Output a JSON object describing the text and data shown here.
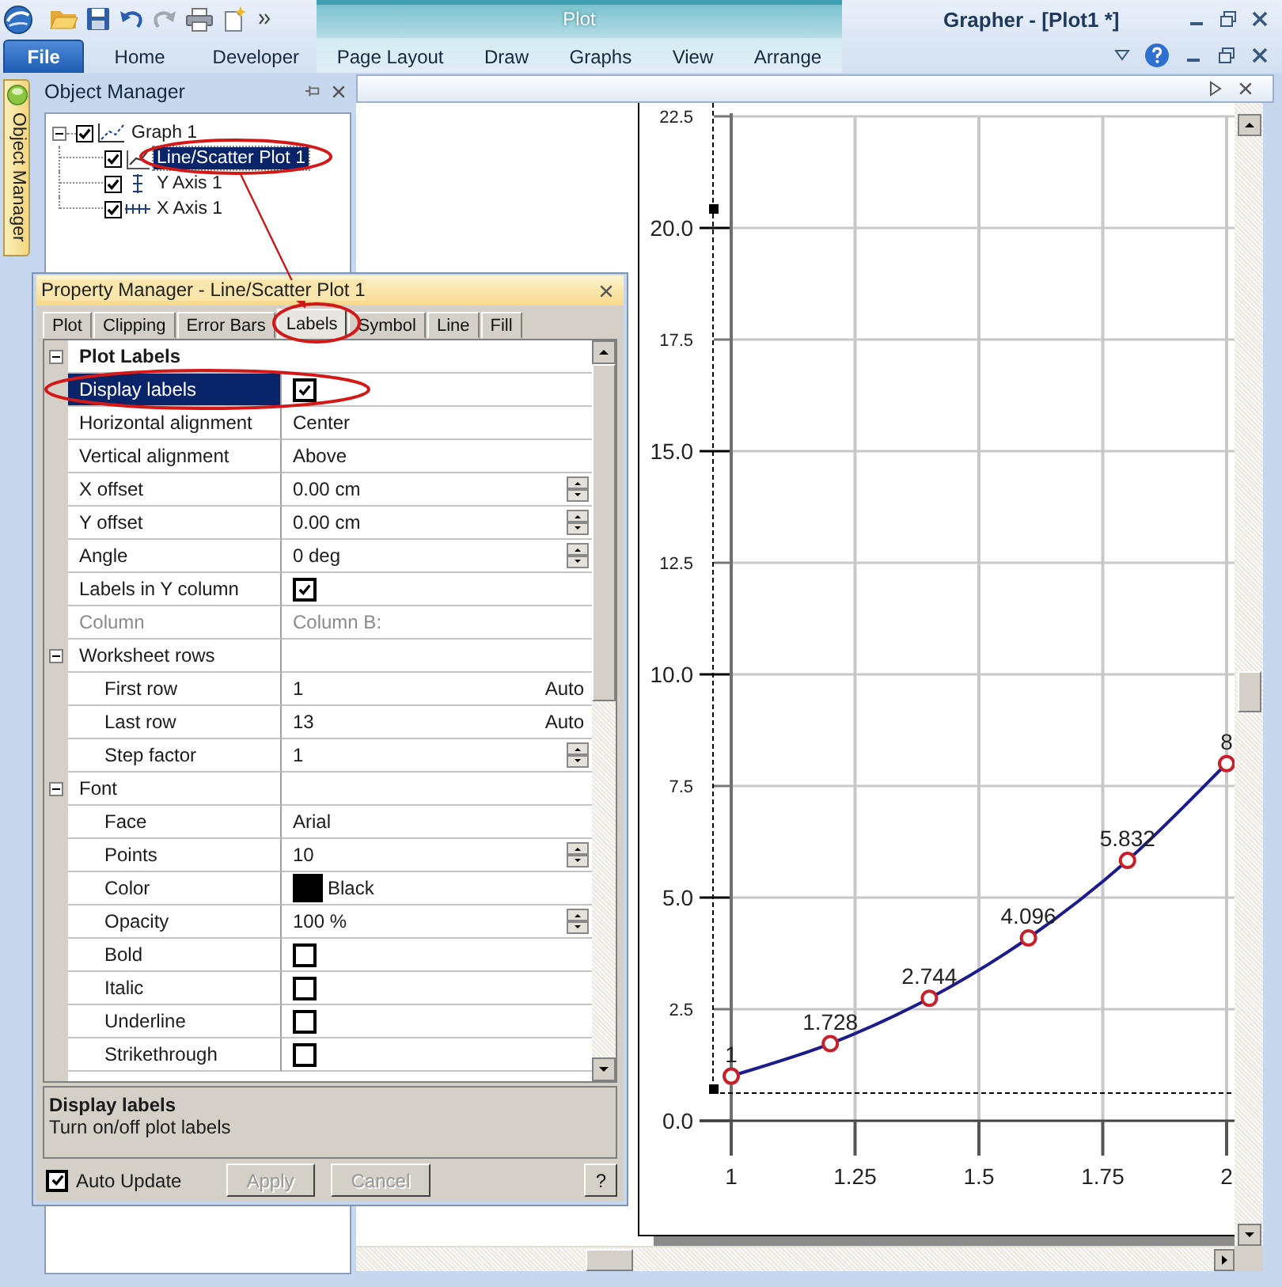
{
  "quick_access": [
    {
      "kind": "open",
      "disabled": false
    },
    {
      "kind": "save",
      "disabled": false
    },
    {
      "kind": "undo",
      "disabled": false
    },
    {
      "kind": "redo",
      "disabled": true
    },
    {
      "kind": "print",
      "disabled": false
    },
    {
      "kind": "new",
      "disabled": false
    },
    {
      "kind": "more",
      "disabled": false
    }
  ],
  "window": {
    "title": "Grapher - [Plot1 *]"
  },
  "ribbon": {
    "file_button": "File",
    "tabs": [
      {
        "label": "Home",
        "selected": false
      },
      {
        "label": "Developer",
        "selected": false
      }
    ],
    "context_group": {
      "label": "Plot",
      "tabs": [
        {
          "label": "Page Layout",
          "selected": false
        },
        {
          "label": "Draw",
          "selected": false
        },
        {
          "label": "Graphs",
          "selected": false
        },
        {
          "label": "View",
          "selected": false
        },
        {
          "label": "Arrange",
          "selected": false
        }
      ]
    }
  },
  "object_manager": {
    "side_tab": "Object Manager",
    "title": "Object Manager",
    "tree": [
      {
        "label": "Graph 1",
        "kind": "graph",
        "checked": true,
        "selected": false,
        "expanded": true,
        "children": [
          {
            "label": "Line/Scatter Plot 1",
            "kind": "plot",
            "checked": true,
            "selected": true
          },
          {
            "label": "Y Axis 1",
            "kind": "y_axis",
            "checked": true,
            "selected": false
          },
          {
            "label": "X Axis 1",
            "kind": "x_axis",
            "checked": true,
            "selected": false
          }
        ]
      }
    ]
  },
  "property_manager": {
    "title": "Property Manager - Line/Scatter Plot 1",
    "tabs": [
      {
        "label": "Plot",
        "selected": false
      },
      {
        "label": "Clipping",
        "selected": false
      },
      {
        "label": "Error Bars",
        "selected": false
      },
      {
        "label": "Labels",
        "selected": true
      },
      {
        "label": "Symbol",
        "selected": false
      },
      {
        "label": "Line",
        "selected": false
      },
      {
        "label": "Fill",
        "selected": false
      }
    ],
    "rows": [
      {
        "name": "Plot Labels",
        "kind": "category",
        "expanded": true,
        "selected": false,
        "children": [
          {
            "name": "Display labels",
            "kind": "check",
            "checked": true,
            "selected": true,
            "disabled": false
          },
          {
            "name": "Horizontal alignment",
            "kind": "text",
            "value": "Center",
            "selected": false,
            "disabled": false
          },
          {
            "name": "Vertical alignment",
            "kind": "text",
            "value": "Above",
            "selected": false,
            "disabled": false
          },
          {
            "name": "X offset",
            "kind": "spin",
            "value": "0.00 cm",
            "selected": false,
            "disabled": false
          },
          {
            "name": "Y offset",
            "kind": "spin",
            "value": "0.00 cm",
            "selected": false,
            "disabled": false
          },
          {
            "name": "Angle",
            "kind": "spin",
            "value": "0 deg",
            "selected": false,
            "disabled": false
          },
          {
            "name": "Labels in Y column",
            "kind": "check",
            "checked": true,
            "selected": false,
            "disabled": false
          },
          {
            "name": "Column",
            "kind": "text",
            "value": "Column B:",
            "selected": false,
            "disabled": true
          },
          {
            "name": "Worksheet rows",
            "kind": "category",
            "expanded": true,
            "selected": false,
            "children": [
              {
                "name": "First row",
                "kind": "auto",
                "value": "1",
                "mode": "Auto",
                "selected": false,
                "disabled": false
              },
              {
                "name": "Last row",
                "kind": "auto",
                "value": "13",
                "mode": "Auto",
                "selected": false,
                "disabled": false
              },
              {
                "name": "Step factor",
                "kind": "spin",
                "value": "1",
                "selected": false,
                "disabled": false
              }
            ]
          },
          {
            "name": "Font",
            "kind": "category",
            "expanded": true,
            "selected": false,
            "children": [
              {
                "name": "Face",
                "kind": "text",
                "value": "Arial",
                "selected": false,
                "disabled": false
              },
              {
                "name": "Points",
                "kind": "spin",
                "value": "10",
                "selected": false,
                "disabled": false
              },
              {
                "name": "Color",
                "kind": "color",
                "value": "Black",
                "color": "#000000",
                "selected": false,
                "disabled": false
              },
              {
                "name": "Opacity",
                "kind": "spin",
                "value": "100 %",
                "selected": false,
                "disabled": false
              },
              {
                "name": "Bold",
                "kind": "check",
                "checked": false,
                "selected": false,
                "disabled": false
              },
              {
                "name": "Italic",
                "kind": "check",
                "checked": false,
                "selected": false,
                "disabled": false
              },
              {
                "name": "Underline",
                "kind": "check",
                "checked": false,
                "selected": false,
                "disabled": false
              },
              {
                "name": "Strikethrough",
                "kind": "check",
                "checked": false,
                "selected": false,
                "disabled": false
              }
            ]
          }
        ]
      }
    ],
    "description": {
      "title": "Display labels",
      "text": "Turn on/off plot labels"
    },
    "auto_update": {
      "label": "Auto Update",
      "checked": true
    },
    "buttons": [
      {
        "label": "Apply",
        "disabled": true
      },
      {
        "label": "Cancel",
        "disabled": true
      }
    ],
    "help_button": "?"
  },
  "document": {
    "chart_data": {
      "type": "line",
      "grid": true,
      "x": [
        1,
        1.2,
        1.4,
        1.6,
        1.8,
        2
      ],
      "series": [
        {
          "color": "#1c1c8c",
          "marker": "circle",
          "values": [
            1,
            1.728,
            2.744,
            4.096,
            5.832,
            8
          ]
        }
      ],
      "xlim": [
        1,
        2
      ],
      "ylim": [
        0,
        22.5
      ],
      "xticks": [
        1,
        1.25,
        1.5,
        1.75,
        2
      ],
      "yticks": [
        {
          "value": 0,
          "label": "0.0"
        },
        {
          "value": 2.5,
          "label": "2.5"
        },
        {
          "value": 5,
          "label": "5.0"
        },
        {
          "value": 7.5,
          "label": "7.5"
        },
        {
          "value": 10,
          "label": "10.0"
        },
        {
          "value": 12.5,
          "label": "12.5"
        },
        {
          "value": 15,
          "label": "15.0"
        },
        {
          "value": 17.5,
          "label": "17.5"
        },
        {
          "value": 20,
          "label": "20.0"
        },
        {
          "value": 22.5,
          "label": "22.5"
        }
      ],
      "value_labels": [
        "1",
        "1.728",
        "2.744",
        "4.096",
        "5.832",
        "8"
      ]
    }
  }
}
